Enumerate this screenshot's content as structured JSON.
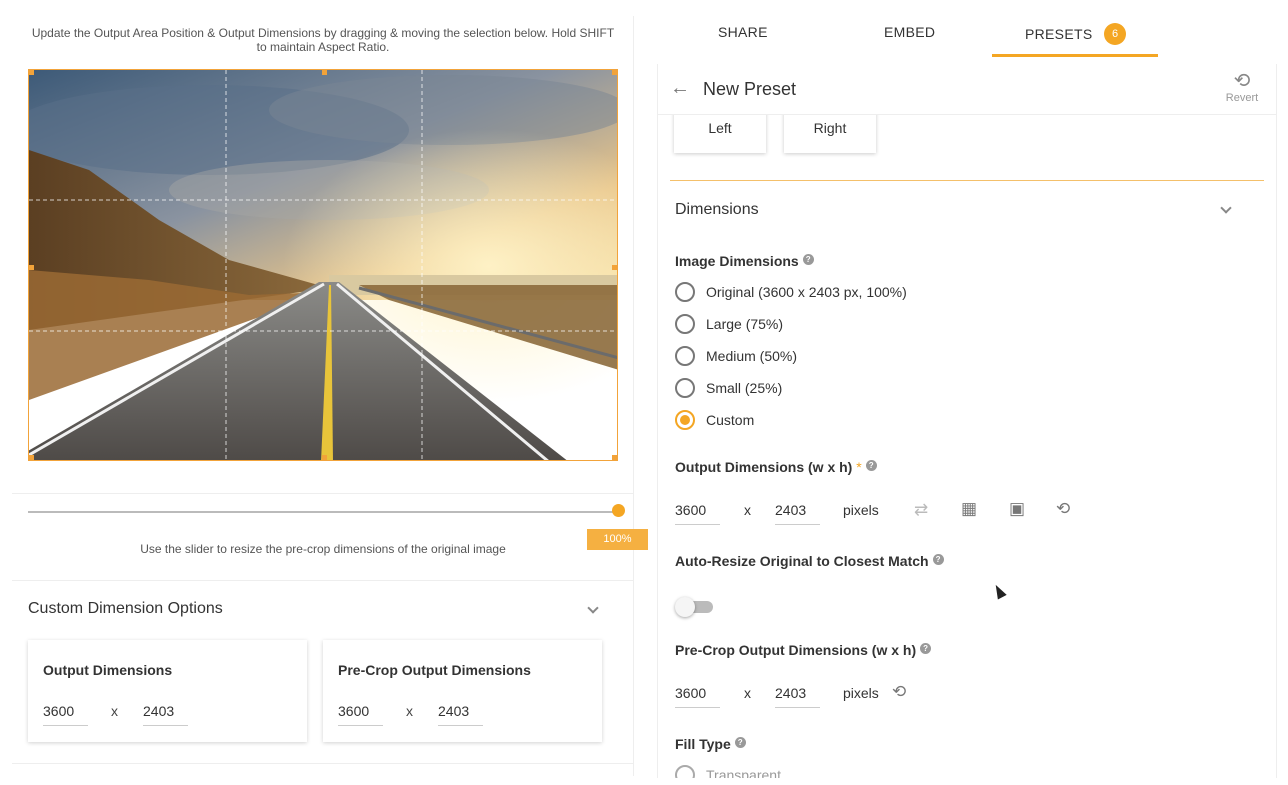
{
  "editor": {
    "instruction": "Update the Output Area Position & Output Dimensions by dragging & moving the selection below. Hold SHIFT to maintain Aspect Ratio.",
    "slider_value": "100%",
    "slider_fraction": 1.0,
    "slider_note": "Use the slider to resize the pre-crop dimensions of the original image"
  },
  "custom_dimension_options": {
    "title": "Custom Dimension Options",
    "output": {
      "title": "Output Dimensions",
      "width": "3600",
      "sep": "x",
      "height": "2403"
    },
    "precrop": {
      "title": "Pre-Crop Output Dimensions",
      "width": "3600",
      "sep": "x",
      "height": "2403"
    }
  },
  "tabs": [
    {
      "label": "SHARE"
    },
    {
      "label": "EMBED"
    },
    {
      "label": "PRESETS",
      "badge": "6",
      "active": true
    }
  ],
  "preset": {
    "title": "New Preset",
    "revert_label": "Revert",
    "align_buttons": [
      "Left",
      "Right"
    ],
    "section_title": "Dimensions",
    "image_dimensions": {
      "label": "Image Dimensions",
      "options": [
        "Original (3600 x 2403 px, 100%)",
        "Large (75%)",
        "Medium (50%)",
        "Small (25%)",
        "Custom"
      ],
      "selected": "Custom"
    },
    "output_dimensions": {
      "label": "Output Dimensions (w x h)",
      "required_mark": "*",
      "width": "3600",
      "sep": "x",
      "height": "2403",
      "unit": "pixels"
    },
    "auto_resize": {
      "label": "Auto-Resize Original to Closest Match",
      "enabled": false
    },
    "precrop_dimensions": {
      "label": "Pre-Crop Output Dimensions (w x h)",
      "width": "3600",
      "sep": "x",
      "height": "2403",
      "unit": "pixels"
    },
    "fill_type": {
      "label": "Fill Type",
      "first_option": "Transparent"
    }
  },
  "colors": {
    "accent": "#f4a623",
    "text": "#333333"
  },
  "icons": [
    "back-arrow-icon",
    "revert-icon",
    "chevron-down-icon",
    "swap-icon",
    "fit-icon",
    "expand-icon",
    "reset-icon",
    "help-icon"
  ]
}
